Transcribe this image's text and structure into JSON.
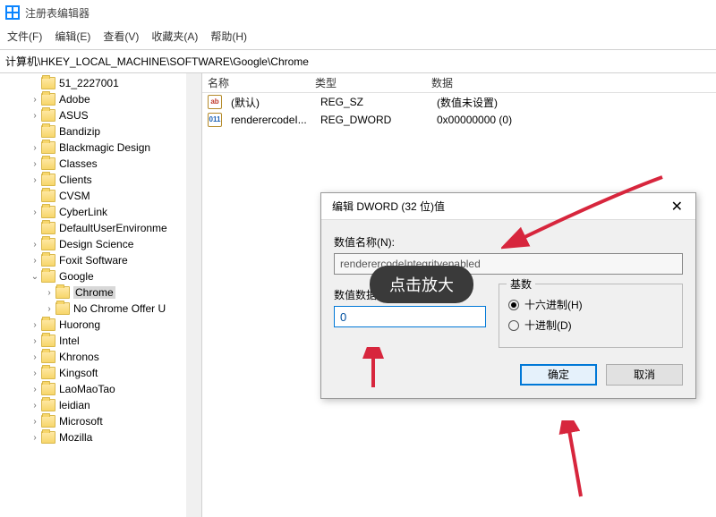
{
  "window": {
    "title": "注册表编辑器"
  },
  "menu": {
    "file": "文件(F)",
    "edit": "编辑(E)",
    "view": "查看(V)",
    "favorites": "收藏夹(A)",
    "help": "帮助(H)"
  },
  "address": "计算机\\HKEY_LOCAL_MACHINE\\SOFTWARE\\Google\\Chrome",
  "tree": [
    {
      "label": "51_2227001",
      "depth": 2,
      "expander": ""
    },
    {
      "label": "Adobe",
      "depth": 2,
      "expander": "›"
    },
    {
      "label": "ASUS",
      "depth": 2,
      "expander": "›"
    },
    {
      "label": "Bandizip",
      "depth": 2,
      "expander": ""
    },
    {
      "label": "Blackmagic Design",
      "depth": 2,
      "expander": "›"
    },
    {
      "label": "Classes",
      "depth": 2,
      "expander": "›"
    },
    {
      "label": "Clients",
      "depth": 2,
      "expander": "›"
    },
    {
      "label": "CVSM",
      "depth": 2,
      "expander": ""
    },
    {
      "label": "CyberLink",
      "depth": 2,
      "expander": "›"
    },
    {
      "label": "DefaultUserEnvironme",
      "depth": 2,
      "expander": ""
    },
    {
      "label": "Design Science",
      "depth": 2,
      "expander": "›"
    },
    {
      "label": "Foxit Software",
      "depth": 2,
      "expander": "›"
    },
    {
      "label": "Google",
      "depth": 2,
      "expander": "⌄"
    },
    {
      "label": "Chrome",
      "depth": 3,
      "expander": "›",
      "selected": true
    },
    {
      "label": "No Chrome Offer U",
      "depth": 3,
      "expander": "›"
    },
    {
      "label": "Huorong",
      "depth": 2,
      "expander": "›"
    },
    {
      "label": "Intel",
      "depth": 2,
      "expander": "›"
    },
    {
      "label": "Khronos",
      "depth": 2,
      "expander": "›"
    },
    {
      "label": "Kingsoft",
      "depth": 2,
      "expander": "›"
    },
    {
      "label": "LaoMaoTao",
      "depth": 2,
      "expander": "›"
    },
    {
      "label": "leidian",
      "depth": 2,
      "expander": "›"
    },
    {
      "label": "Microsoft",
      "depth": 2,
      "expander": "›"
    },
    {
      "label": "Mozilla",
      "depth": 2,
      "expander": "›"
    }
  ],
  "columns": {
    "name": "名称",
    "type": "类型",
    "data": "数据"
  },
  "rows": [
    {
      "icon": "ab",
      "name": "(默认)",
      "type": "REG_SZ",
      "data": "(数值未设置)"
    },
    {
      "icon": "bin",
      "name": "renderercodeI...",
      "type": "REG_DWORD",
      "data": "0x00000000 (0)"
    }
  ],
  "dialog": {
    "title": "编辑 DWORD (32 位)值",
    "close": "✕",
    "name_label": "数值名称(N):",
    "name_value": "renderercodeIntegrityenabled",
    "data_label": "数值数据(V):",
    "data_value": "0",
    "radix_label": "基数",
    "hex_label": "十六进制(H)",
    "dec_label": "十进制(D)",
    "ok": "确定",
    "cancel": "取消"
  },
  "overlay": {
    "tooltip": "点击放大"
  }
}
